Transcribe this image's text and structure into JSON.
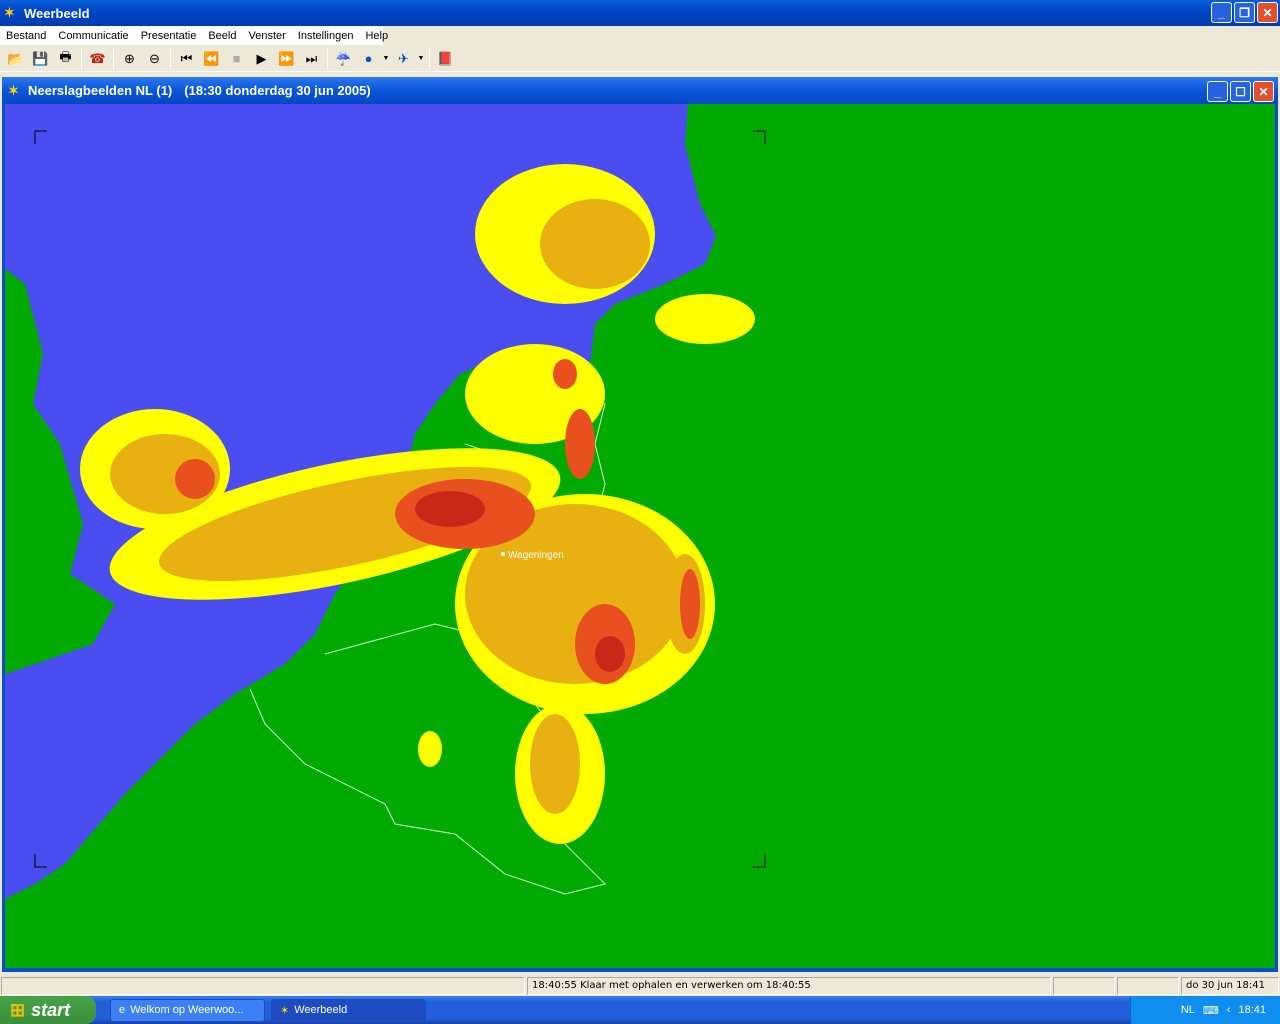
{
  "app": {
    "title": "Weerbeeld"
  },
  "menu": [
    "Bestand",
    "Communicatie",
    "Presentatie",
    "Beeld",
    "Venster",
    "Instellingen",
    "Help"
  ],
  "toolbar": {
    "icons": [
      "open-icon",
      "save-icon",
      "print-icon",
      "phone-icon",
      "zoom-in-icon",
      "zoom-out-icon",
      "first-icon",
      "rewind-icon",
      "stop-icon",
      "play-icon",
      "fast-forward-icon",
      "last-icon",
      "weather-icon",
      "globe-icon",
      "satellite-icon",
      "help-book-icon"
    ]
  },
  "child": {
    "title": "Neerslagbeelden NL (1)",
    "subtitle": "(18:30 donderdag 30 jun 2005)"
  },
  "map": {
    "city_label": "Wageningen",
    "colors": {
      "sea": "#4a4ef0",
      "land": "#00aa00",
      "light": "#ffff00",
      "medium": "#e8b010",
      "heavy": "#e85020",
      "extreme": "#c82818"
    }
  },
  "status": {
    "message": "18:40:55 Klaar met ophalen en verwerken om 18:40:55",
    "date": "do 30 jun 18:41"
  },
  "taskbar": {
    "start": "start",
    "tasks": [
      "Welkom op Weerwoo...",
      "Weerbeeld"
    ],
    "lang": "NL",
    "clock": "18:41"
  }
}
